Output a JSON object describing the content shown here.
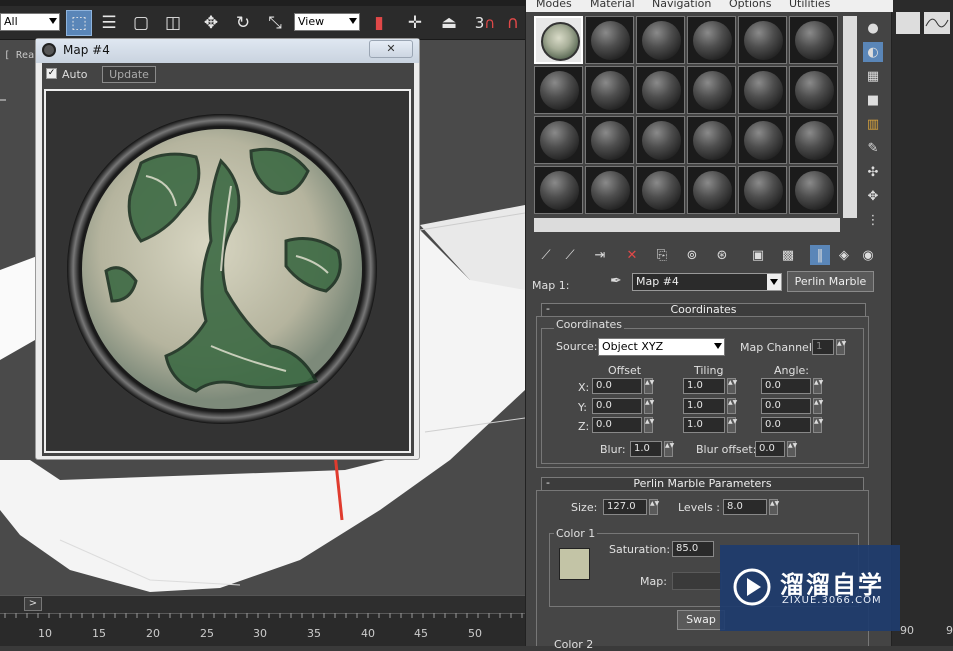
{
  "toolbar": {
    "selection_filter": "All",
    "reference_coord": "View",
    "snap_label": "3"
  },
  "viewport": {
    "label": "[ Real"
  },
  "timeline": {
    "arrow": ">",
    "ticks": [
      "10",
      "15",
      "20",
      "25",
      "30",
      "35",
      "40",
      "45",
      "50",
      "90",
      "9"
    ]
  },
  "map_window": {
    "title": "Map #4",
    "auto_label": "Auto",
    "auto_checked": true,
    "update_label": "Update",
    "close_glyph": "✕"
  },
  "material_editor": {
    "menu": [
      "Modes",
      "Material",
      "Navigation",
      "Options",
      "Utilities"
    ],
    "map_label": "Map 1:",
    "map_name": "Map #4",
    "map_type": "Perlin Marble",
    "coordinates": {
      "header": "Coordinates",
      "group": "Coordinates",
      "source_label": "Source:",
      "source_value": "Object XYZ",
      "map_channel_label": "Map Channel:",
      "map_channel_value": "1",
      "offset_label": "Offset",
      "tiling_label": "Tiling",
      "angle_label": "Angle:",
      "rows": [
        {
          "axis": "X:",
          "offset": "0.0",
          "tiling": "1.0",
          "angle": "0.0"
        },
        {
          "axis": "Y:",
          "offset": "0.0",
          "tiling": "1.0",
          "angle": "0.0"
        },
        {
          "axis": "Z:",
          "offset": "0.0",
          "tiling": "1.0",
          "angle": "0.0"
        }
      ],
      "blur_label": "Blur:",
      "blur_value": "1.0",
      "blur_offset_label": "Blur offset:",
      "blur_offset_value": "0.0"
    },
    "perlin": {
      "header": "Perlin Marble Parameters",
      "size_label": "Size:",
      "size_value": "127.0",
      "levels_label": "Levels :",
      "levels_value": "8.0",
      "color1_label": "Color 1",
      "color1_hex": "#c3c4a6",
      "saturation_label": "Saturation:",
      "saturation_value": "85.0",
      "map_label": "Map:",
      "swap_label": "Swap",
      "color2_label": "Color 2"
    }
  },
  "watermark": {
    "title": "溜溜自学",
    "url": "ZIXUE.3066.COM"
  },
  "colors": {
    "accent": "#5a86b8",
    "arrow": "#e03b2e"
  }
}
